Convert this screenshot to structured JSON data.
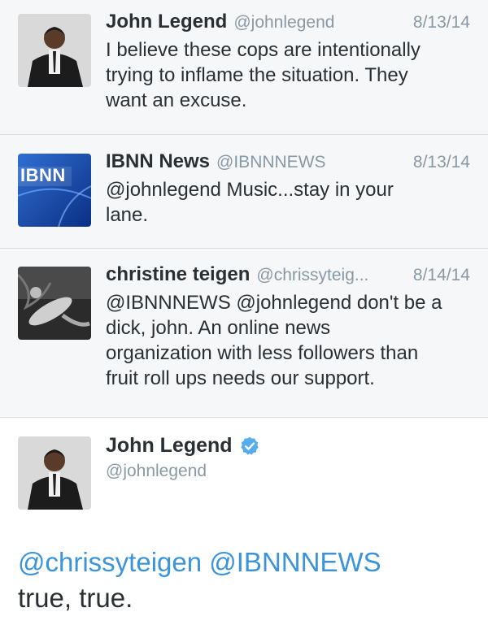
{
  "tweets": [
    {
      "name": "John Legend",
      "handle": "@johnlegend",
      "date": "8/13/14",
      "lines": [
        "I believe these cops are intentionally",
        "trying to inflame the situation.  They",
        "want an excuse."
      ]
    },
    {
      "name": "IBNN News",
      "handle": "@IBNNNEWS",
      "date": "8/13/14",
      "avatar_text": "IBNN",
      "lines": [
        "@johnlegend Music...stay in your",
        "lane."
      ]
    },
    {
      "name": "christine teigen",
      "handle": "@chrissyteig...",
      "date": "8/14/14",
      "lines": [
        "@IBNNNEWS @johnlegend don't be a",
        "dick, john. An online news",
        "organization with less followers than",
        "fruit roll ups needs our support."
      ]
    }
  ],
  "expanded": {
    "name": "John Legend",
    "handle": "@johnlegend",
    "mention1": "@chrissyteigen",
    "mention2": "@IBNNNEWS",
    "text": "true, true."
  },
  "colors": {
    "mention": "#3b94d9",
    "verified": "#55acee",
    "muted": "#8899a6"
  }
}
